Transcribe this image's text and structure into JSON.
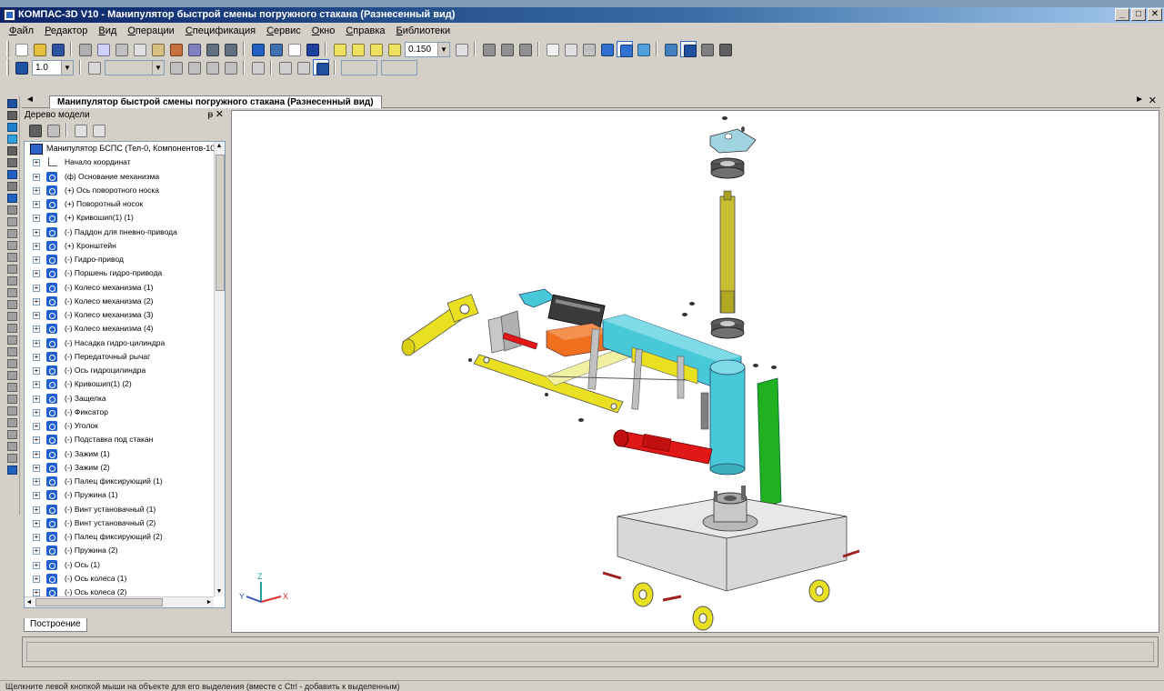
{
  "window": {
    "title": "КОМПАС-3D V10 - Манипулятор быстрой смены погружного стакана (Разнесенный вид)",
    "buttons": [
      "_",
      "□",
      "✕"
    ]
  },
  "menu": [
    "Файл",
    "Редактор",
    "Вид",
    "Операции",
    "Спецификация",
    "Сервис",
    "Окно",
    "Справка",
    "Библиотеки"
  ],
  "toolbar": {
    "zoom_value": "0.150",
    "step_value": "1.0"
  },
  "document_tab": {
    "title": "Манипулятор быстрой смены погружного стакана (Разнесенный вид)"
  },
  "tree_panel": {
    "header": "Дерево модели",
    "root": "Манипулятор БСПС (Тел-0, Компонентов-102)",
    "origin": "Начало координат",
    "items": [
      "(ф) Основание механизма",
      "(+) Ось поворотного носка",
      "(+) Поворотный носок",
      "(+) Кривошип(1) (1)",
      "(-) Паддон для пневно-привода",
      "(+) Кронштейн",
      "(-) Гидро-привод",
      "(-) Поршень гидро-привода",
      "(-) Колесо механизма (1)",
      "(-) Колесо механизма (2)",
      "(-) Колесо механизма (3)",
      "(-) Колесо механизма (4)",
      "(-) Насадка гидро-цилиндра",
      "(-) Передаточный рычаг",
      "(-) Ось гидроцилиндра",
      "(-) Кривошип(1) (2)",
      "(-) Защелка",
      "(-) Фиксатор",
      "(-) Уголок",
      "(-) Подставка под стакан",
      "(-) Зажим (1)",
      "(-) Зажим (2)",
      "(-) Палец фиксирующий (1)",
      "(-) Пружина (1)",
      "(-) Винт установачный (1)",
      "(-) Винт установачный (2)",
      "(-) Палец фиксирующий (2)",
      "(-) Пружина (2)",
      "(-) Ось (1)",
      "(-) Ось колеса (1)",
      "(-) Ось колеса (2)"
    ],
    "bottom_tab": "Построение"
  },
  "viewport": {
    "axis_labels": {
      "x": "X",
      "y": "Y",
      "z": "Z"
    }
  },
  "colors": {
    "yellow_part": "#e8e020",
    "cyan_part": "#48c8d8",
    "red_part": "#e01818",
    "green_part": "#20b020",
    "orange_part": "#f07020",
    "base_gray": "#d8d8d8",
    "olive_shaft": "#c8c030",
    "tree_icon_blue": "#1f5fd0"
  },
  "statusbar": {
    "text": "Щелкните левой кнопкой мыши на объекте для его выделения (вместе с Ctrl - добавить к выделенным)"
  }
}
